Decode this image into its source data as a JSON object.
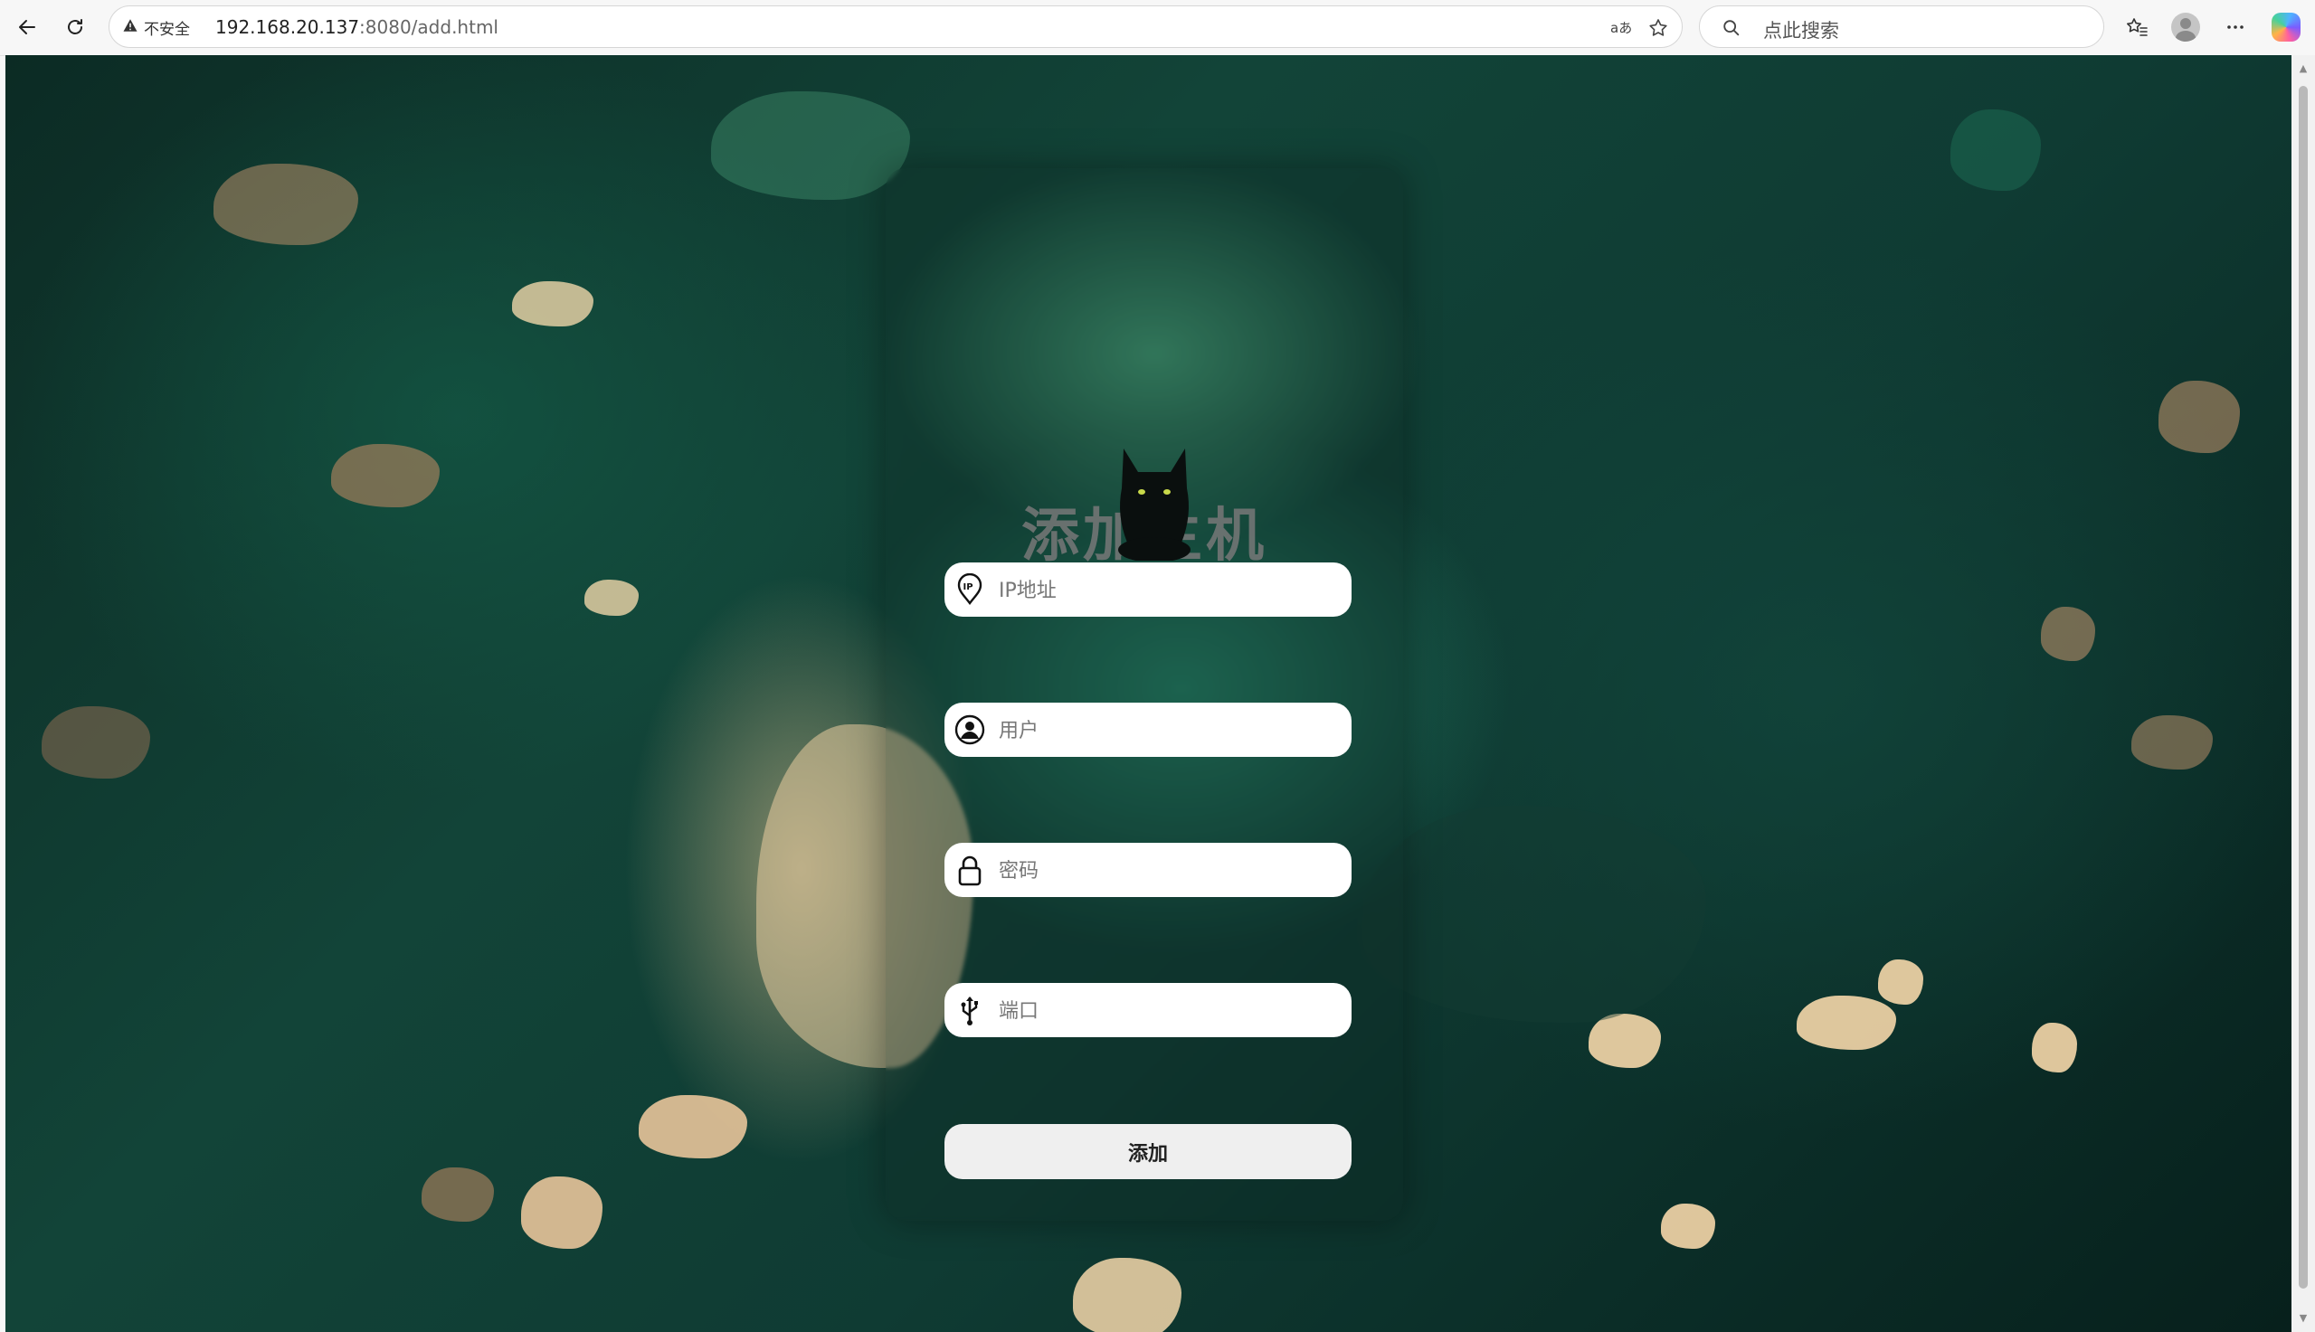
{
  "browser": {
    "security_label": "不安全",
    "url_host": "192.168.20.137",
    "url_rest": ":8080/add.html",
    "search_placeholder": "点此搜索",
    "icons": {
      "back": "back-arrow-icon",
      "reload": "reload-icon",
      "warning": "warning-icon",
      "read_aloud": "read-aloud-icon",
      "favorite": "star-icon",
      "search": "search-icon",
      "favorites_bar": "favorites-icon",
      "profile": "avatar",
      "more": "more-icon",
      "copilot": "copilot-icon"
    }
  },
  "form": {
    "title": "添加主机",
    "fields": [
      {
        "placeholder": "IP地址",
        "icon": "ip-location-icon"
      },
      {
        "placeholder": "用户",
        "icon": "user-icon"
      },
      {
        "placeholder": "密码",
        "icon": "lock-icon"
      },
      {
        "placeholder": "端口",
        "icon": "usb-icon"
      }
    ],
    "submit_label": "添加"
  },
  "colors": {
    "card_bg": "rgba(10,30,26,0.25)",
    "title_color": "#787878",
    "field_bg": "#ffffff",
    "button_bg": "#efefef"
  }
}
